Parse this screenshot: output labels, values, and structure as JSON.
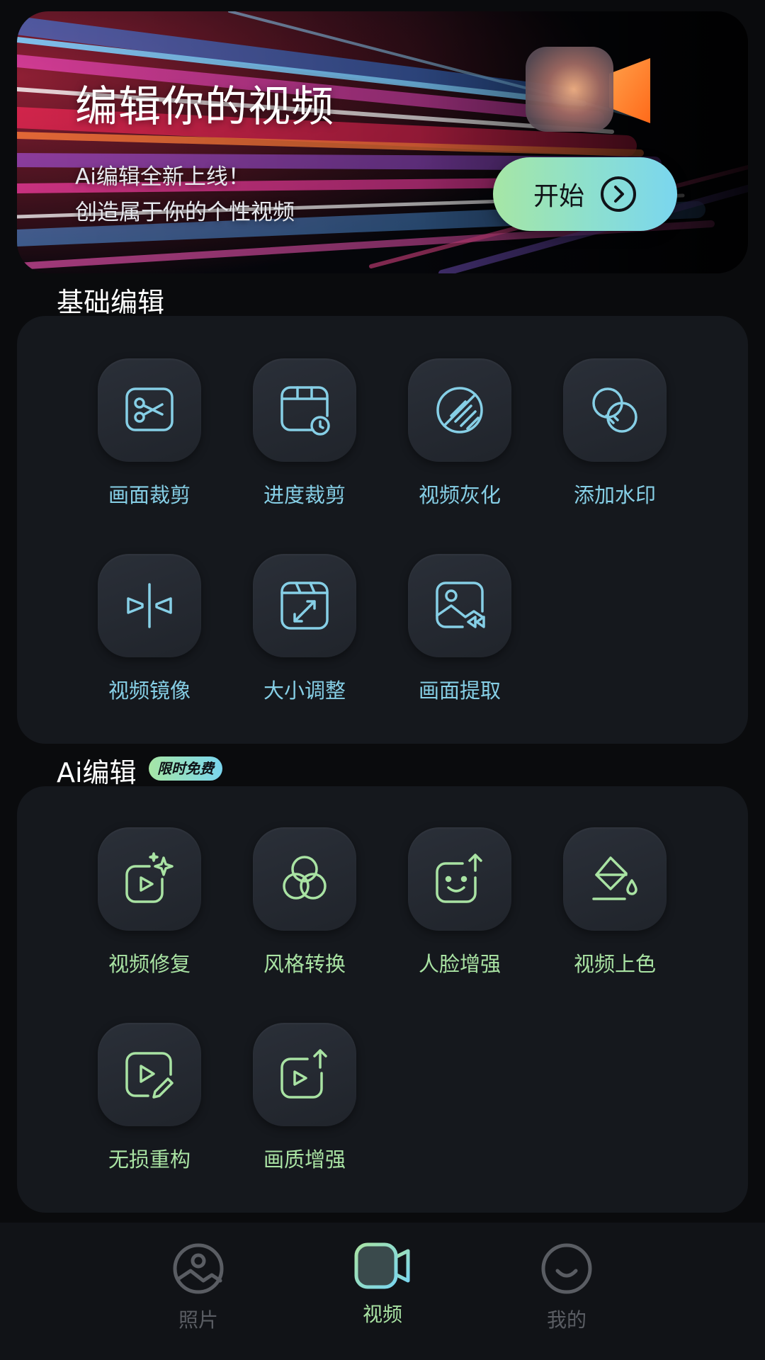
{
  "banner": {
    "title": "编辑你的视频",
    "subtitle_line1": "Ai编辑全新上线！",
    "subtitle_line2": "创造属于你的个性视频",
    "start_label": "开始"
  },
  "basic_section": {
    "title": "基础编辑",
    "items": [
      {
        "label": "画面裁剪",
        "icon": "scissors-icon"
      },
      {
        "label": "进度裁剪",
        "icon": "timeline-clock-icon"
      },
      {
        "label": "视频灰化",
        "icon": "grayscale-icon"
      },
      {
        "label": "添加水印",
        "icon": "watermark-icon"
      },
      {
        "label": "视频镜像",
        "icon": "mirror-icon"
      },
      {
        "label": "大小调整",
        "icon": "resize-icon"
      },
      {
        "label": "画面提取",
        "icon": "frame-extract-icon"
      }
    ]
  },
  "ai_section": {
    "title": "Ai编辑",
    "badge": "限时免费",
    "items": [
      {
        "label": "视频修复",
        "icon": "video-repair-icon"
      },
      {
        "label": "风格转换",
        "icon": "style-transfer-icon"
      },
      {
        "label": "人脸增强",
        "icon": "face-enhance-icon"
      },
      {
        "label": "视频上色",
        "icon": "colorize-icon"
      },
      {
        "label": "无损重构",
        "icon": "lossless-rebuild-icon"
      },
      {
        "label": "画质增强",
        "icon": "quality-enhance-icon"
      }
    ]
  },
  "bottom_nav": {
    "items": [
      {
        "label": "照片",
        "icon": "photo-icon",
        "active": false
      },
      {
        "label": "视频",
        "icon": "video-camera-icon",
        "active": true
      },
      {
        "label": "我的",
        "icon": "profile-smile-icon",
        "active": false
      }
    ]
  },
  "colors": {
    "background": "#0a0b0d",
    "panel": "#15181d",
    "basic_accent": "#86cfe6",
    "ai_accent": "#a9e3a3",
    "nav_active": "#a9e3a3",
    "nav_inactive": "#5a5d63"
  }
}
